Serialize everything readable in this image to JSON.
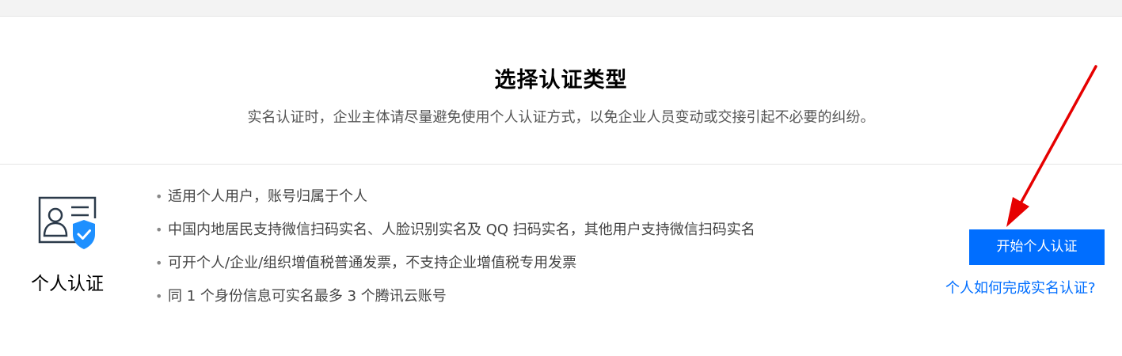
{
  "page": {
    "title": "选择认证类型",
    "subtitle": "实名认证时，企业主体请尽量避免使用个人认证方式，以免企业人员变动或交接引起不必要的纠纷。"
  },
  "personal": {
    "icon": "id-card-shield-icon",
    "name": "个人认证",
    "bullet": "•",
    "features": [
      "适用个人用户，账号归属于个人",
      "中国内地居民支持微信扫码实名、人脸识别实名及 QQ 扫码实名，其他用户支持微信扫码实名",
      "可开个人/企业/组织增值税普通发票，不支持企业增值税专用发票",
      "同 1 个身份信息可实名最多 3 个腾讯云账号"
    ],
    "start_button": "开始个人认证",
    "help_link": "个人如何完成实名认证?"
  },
  "colors": {
    "accent": "#006eff",
    "annotation_arrow": "#e60000",
    "icon_stroke": "#2b3a4a"
  }
}
